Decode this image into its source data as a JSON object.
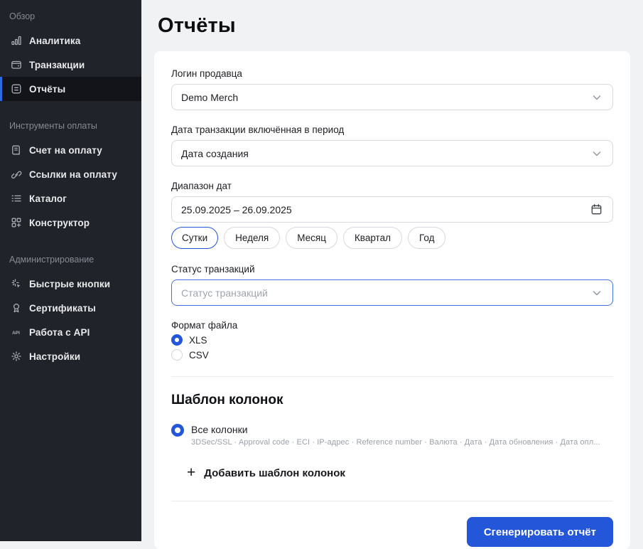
{
  "sidebar": {
    "sections": [
      {
        "label": "Обзор",
        "items": [
          {
            "label": "Аналитика"
          },
          {
            "label": "Транзакции"
          },
          {
            "label": "Отчёты"
          }
        ]
      },
      {
        "label": "Инструменты оплаты",
        "items": [
          {
            "label": "Счет на оплату"
          },
          {
            "label": "Ссылки на оплату"
          },
          {
            "label": "Каталог"
          },
          {
            "label": "Конструктор"
          }
        ]
      },
      {
        "label": "Администрирование",
        "items": [
          {
            "label": "Быстрые кнопки"
          },
          {
            "label": "Сертификаты"
          },
          {
            "label": "Работа с API"
          },
          {
            "label": "Настройки"
          }
        ]
      }
    ]
  },
  "page": {
    "title": "Отчёты"
  },
  "form": {
    "merchant_login": {
      "label": "Логин продавца",
      "value": "Demo Merch"
    },
    "date_type": {
      "label": "Дата транзакции включённая в период",
      "value": "Дата создания"
    },
    "date_range": {
      "label": "Диапазон дат",
      "value": "25.09.2025 – 26.09.2025"
    },
    "period_pills": [
      "Сутки",
      "Неделя",
      "Месяц",
      "Квартал",
      "Год"
    ],
    "period_selected": "Сутки",
    "status": {
      "label": "Статус транзакций",
      "placeholder": "Статус транзакций"
    },
    "file_format": {
      "label": "Формат файла",
      "options": [
        "XLS",
        "CSV"
      ],
      "selected": "XLS"
    },
    "columns_template": {
      "heading": "Шаблон колонок",
      "all_columns_label": "Все колонки",
      "all_columns_description": "3DSec/SSL · Approval code · ECI · IP-адрес · Reference number · Валюта · Дата · Дата обновления · Дата опл...",
      "add_template_label": "Добавить шаблон колонок",
      "plus_glyph": "+"
    },
    "submit_label": "Сгенерировать отчёт"
  },
  "colors": {
    "accent": "#2356d9",
    "sidebar_bg": "#20232a",
    "sidebar_active_bg": "#121419",
    "active_border": "#2e6ae3",
    "main_bg": "#f1f2f4",
    "input_border": "#d8d9de",
    "focused_border": "#4274e3"
  }
}
